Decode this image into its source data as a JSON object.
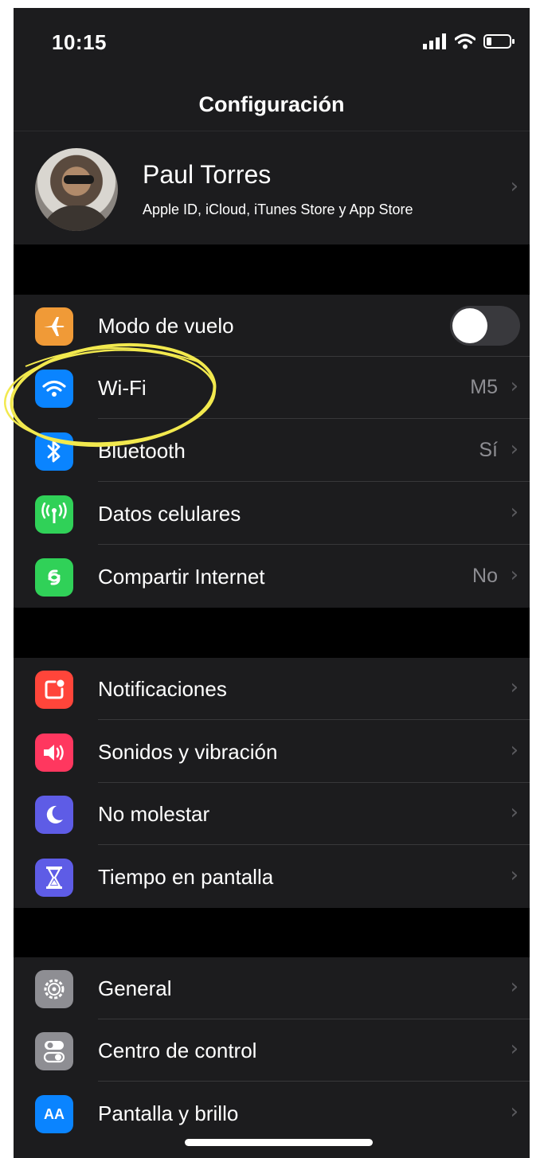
{
  "status_bar": {
    "time": "10:15"
  },
  "nav": {
    "title": "Configuración"
  },
  "profile": {
    "name": "Paul Torres",
    "subtitle": "Apple ID, iCloud, iTunes Store y App Store"
  },
  "groups": {
    "connectivity": [
      {
        "label": "Modo de vuelo",
        "icon": "airplane-icon",
        "color": "#f09a37",
        "toggle": false
      },
      {
        "label": "Wi-Fi",
        "icon": "wifi-icon",
        "color": "#0a84ff",
        "value": "M5"
      },
      {
        "label": "Bluetooth",
        "icon": "bluetooth-icon",
        "color": "#0a84ff",
        "value": "Sí"
      },
      {
        "label": "Datos celulares",
        "icon": "antenna-icon",
        "color": "#30d158"
      },
      {
        "label": "Compartir Internet",
        "icon": "hotspot-icon",
        "color": "#30d158",
        "value": "No"
      }
    ],
    "notifications": [
      {
        "label": "Notificaciones",
        "icon": "notifications-icon",
        "color": "#ff453a"
      },
      {
        "label": "Sonidos y vibración",
        "icon": "speaker-icon",
        "color": "#ff375f"
      },
      {
        "label": "No molestar",
        "icon": "moon-icon",
        "color": "#5e5ce6"
      },
      {
        "label": "Tiempo en pantalla",
        "icon": "hourglass-icon",
        "color": "#5e5ce6"
      }
    ],
    "general": [
      {
        "label": "General",
        "icon": "gear-icon",
        "color": "#8e8e93"
      },
      {
        "label": "Centro de control",
        "icon": "switches-icon",
        "color": "#8e8e93"
      },
      {
        "label": "Pantalla y brillo",
        "icon": "text-size-icon",
        "color": "#0a84ff",
        "glyph": "AA"
      }
    ]
  },
  "annotation": {
    "color": "#f2e94e"
  }
}
